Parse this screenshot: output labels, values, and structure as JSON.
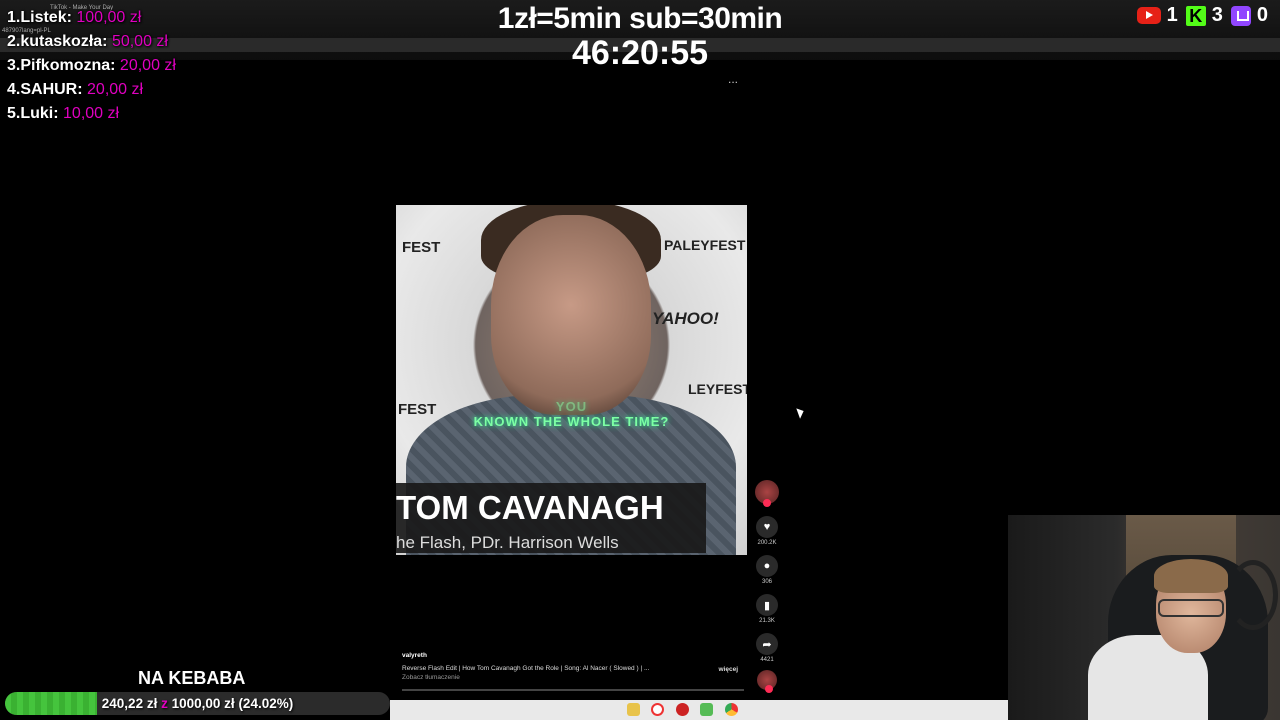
{
  "overlay": {
    "donors": [
      {
        "rank": "1.",
        "name": "Listek:",
        "amount": "100,00 zł"
      },
      {
        "rank": "2.",
        "name": "kutaskozła:",
        "amount": "50,00 zł"
      },
      {
        "rank": "3.",
        "name": "Pifkomozna:",
        "amount": "20,00 zł"
      },
      {
        "rank": "4.",
        "name": "SAHUR:",
        "amount": "20,00 zł"
      },
      {
        "rank": "5.",
        "name": "Luki:",
        "amount": "10,00 zł"
      }
    ],
    "rate_text": "1zł=5min sub=30min",
    "timer": "46:20:55",
    "counters": [
      {
        "platform": "youtube-icon",
        "count": "1"
      },
      {
        "platform": "kick-icon",
        "count": "3"
      },
      {
        "platform": "twitch-icon",
        "count": "0"
      }
    ],
    "colors": {
      "amount": "#e000c0",
      "goal_fill": "#45c43d",
      "youtube": "#e62117",
      "kick": "#53fc18",
      "twitch": "#9146ff"
    }
  },
  "video": {
    "watermarks": {
      "pf1": "FEST",
      "pf2": "PALEYFEST",
      "yahoo": "YAHOO!",
      "pf3": "FEST",
      "pf4": "LEYFEST"
    },
    "caption": "KNOWN THE WHOLE TIME?",
    "caption_faded": "YOU",
    "name": "TOM CAVANAGH",
    "role": "he Flash, PDr. Harrison Wells",
    "more_icon": "..."
  },
  "actions": {
    "likes": "200.2K",
    "comments": "306",
    "saves": "21.3K",
    "shares": "4421"
  },
  "description": {
    "username": "valyreth",
    "text": "Reverse Flash Edit | How Tom Cavanagh Got the Role | Song: Al Nacer ( Slowed ) | ...",
    "more": "więcej",
    "translate": "Zobacz tłumaczenie"
  },
  "goal": {
    "title": "NA KEBABA",
    "current": "240,22 zł",
    "of_word": "z",
    "target": "1000,00 zł",
    "percent_text": "(24.02%)",
    "progress": 0.2402
  },
  "browser_tab": {
    "title": "TikTok - Make Your Day",
    "url_fragment": "487907lang=pl-PL"
  }
}
